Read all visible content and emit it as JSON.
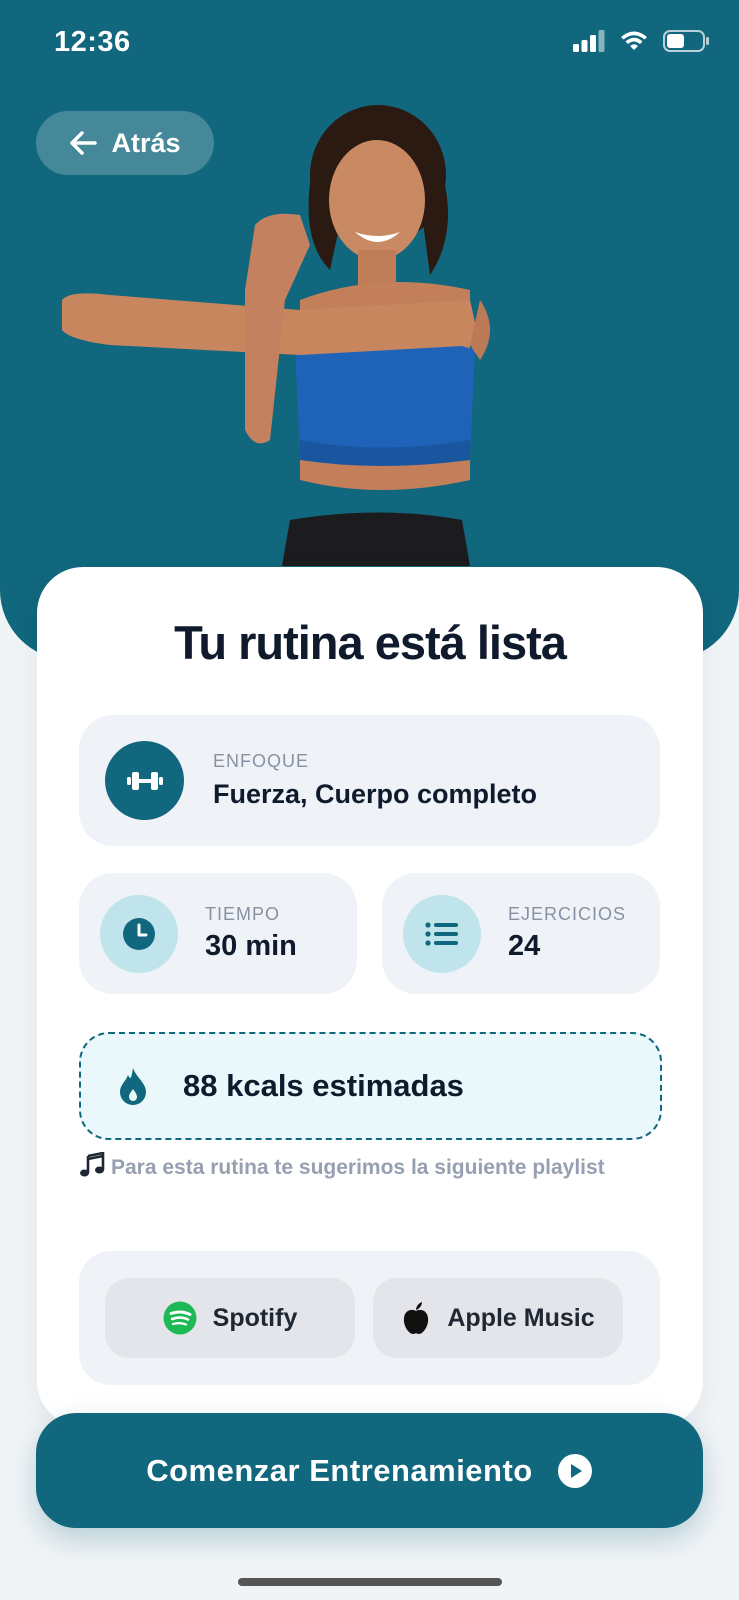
{
  "status_bar": {
    "time": "12:36"
  },
  "header": {
    "back_label": "Atrás"
  },
  "card": {
    "title": "Tu rutina está lista",
    "focus": {
      "label": "ENFOQUE",
      "value": "Fuerza, Cuerpo completo",
      "icon": "dumbbell-icon"
    },
    "time": {
      "label": "TIEMPO",
      "value": "30 min",
      "icon": "clock-icon"
    },
    "exercises": {
      "label": "EJERCICIOS",
      "value": "24",
      "icon": "list-icon"
    },
    "calories": {
      "text": "88 kcals estimadas",
      "icon": "flame-icon"
    },
    "playlist_hint": "Para esta rutina te sugerimos la siguiente playlist",
    "music_options": [
      {
        "label": "Spotify",
        "icon": "spotify-icon"
      },
      {
        "label": "Apple Music",
        "icon": "apple-icon"
      }
    ]
  },
  "cta": {
    "label": "Comenzar Entrenamiento",
    "icon": "play-icon"
  },
  "colors": {
    "primary": "#11677d",
    "tile": "#eff2f7",
    "accent_light": "#bfe4ec",
    "spotify": "#1db954"
  }
}
